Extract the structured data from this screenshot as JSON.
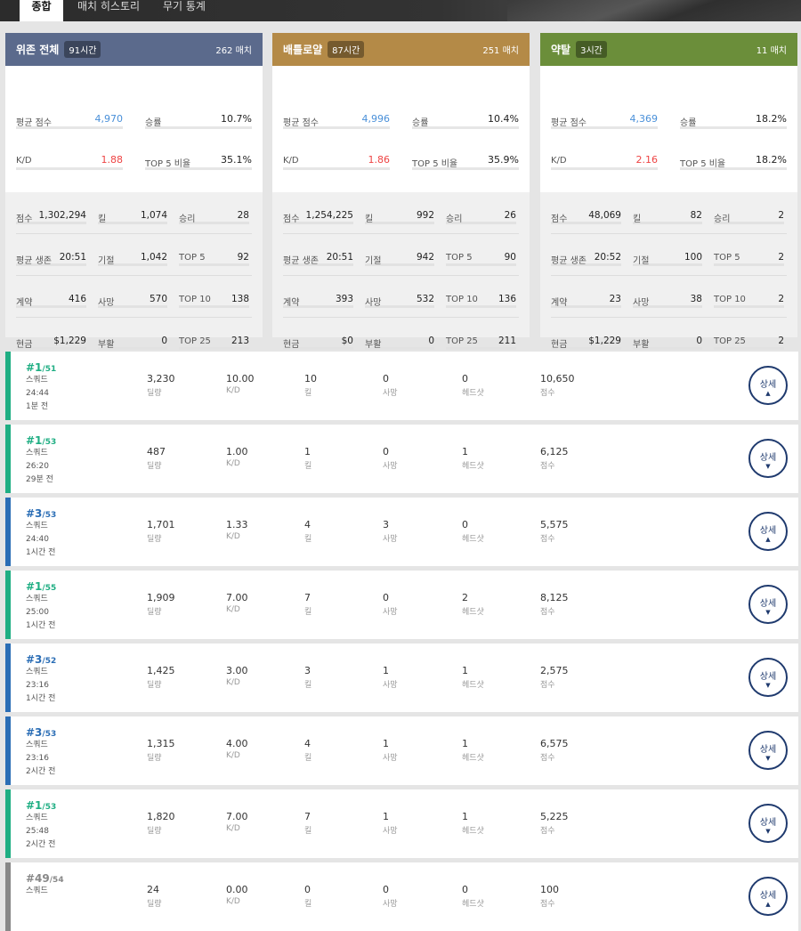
{
  "tabs": [
    "종합",
    "매치 히스토리",
    "무기 통계"
  ],
  "cards": [
    {
      "name": "위존 전체",
      "hours": "91시간",
      "matches": "262 매치",
      "color": "#5b6a8c",
      "avg_score": "4,970",
      "win_rate": "10.7%",
      "kd": "1.88",
      "top5": "35.1%",
      "stats": [
        [
          "점수",
          "1,302,294",
          "킬",
          "1,074",
          "승리",
          "28"
        ],
        [
          "평균 생존",
          "20:51",
          "기절",
          "1,042",
          "TOP 5",
          "92"
        ],
        [
          "계약",
          "416",
          "사망",
          "570",
          "TOP 10",
          "138"
        ],
        [
          "현금",
          "$1,229",
          "부활",
          "0",
          "TOP 25",
          "213"
        ]
      ]
    },
    {
      "name": "배틀로얄",
      "hours": "87시간",
      "matches": "251 매치",
      "color": "#b48a47",
      "avg_score": "4,996",
      "win_rate": "10.4%",
      "kd": "1.86",
      "top5": "35.9%",
      "stats": [
        [
          "점수",
          "1,254,225",
          "킬",
          "992",
          "승리",
          "26"
        ],
        [
          "평균 생존",
          "20:51",
          "기절",
          "942",
          "TOP 5",
          "90"
        ],
        [
          "계약",
          "393",
          "사망",
          "532",
          "TOP 10",
          "136"
        ],
        [
          "현금",
          "$0",
          "부활",
          "0",
          "TOP 25",
          "211"
        ]
      ]
    },
    {
      "name": "약탈",
      "hours": "3시간",
      "matches": "11 매치",
      "color": "#6b8e3a",
      "avg_score": "4,369",
      "win_rate": "18.2%",
      "kd": "2.16",
      "top5": "18.2%",
      "stats": [
        [
          "점수",
          "48,069",
          "킬",
          "82",
          "승리",
          "2"
        ],
        [
          "평균 생존",
          "20:52",
          "기절",
          "100",
          "TOP 5",
          "2"
        ],
        [
          "계약",
          "23",
          "사망",
          "38",
          "TOP 10",
          "2"
        ],
        [
          "현금",
          "$1,229",
          "부활",
          "0",
          "TOP 25",
          "2"
        ]
      ]
    }
  ],
  "card_labels": {
    "avg_score": "평균 점수",
    "win_rate": "승률",
    "kd": "K/D",
    "top5": "TOP 5 비율"
  },
  "match_labels": {
    "damage": "딜량",
    "kd": "K/D",
    "kills": "킬",
    "deaths": "사망",
    "headshots": "헤드샷",
    "score": "점수",
    "detail": "상세"
  },
  "matches": [
    {
      "rank": "#1",
      "total": "/51",
      "mode": "스쿼드",
      "time": "24:44",
      "ago": "1분 전",
      "damage": "3,230",
      "kd": "10.00",
      "kills": "10",
      "deaths": "0",
      "headshots": "0",
      "score": "10,650",
      "color": "#1fae83",
      "open": true
    },
    {
      "rank": "#1",
      "total": "/53",
      "mode": "스쿼드",
      "time": "26:20",
      "ago": "29분 전",
      "damage": "487",
      "kd": "1.00",
      "kills": "1",
      "deaths": "0",
      "headshots": "1",
      "score": "6,125",
      "color": "#1fae83",
      "open": false
    },
    {
      "rank": "#3",
      "total": "/53",
      "mode": "스쿼드",
      "time": "24:40",
      "ago": "1시간 전",
      "damage": "1,701",
      "kd": "1.33",
      "kills": "4",
      "deaths": "3",
      "headshots": "0",
      "score": "5,575",
      "color": "#2a6db5",
      "open": true
    },
    {
      "rank": "#1",
      "total": "/55",
      "mode": "스쿼드",
      "time": "25:00",
      "ago": "1시간 전",
      "damage": "1,909",
      "kd": "7.00",
      "kills": "7",
      "deaths": "0",
      "headshots": "2",
      "score": "8,125",
      "color": "#1fae83",
      "open": false
    },
    {
      "rank": "#3",
      "total": "/52",
      "mode": "스쿼드",
      "time": "23:16",
      "ago": "1시간 전",
      "damage": "1,425",
      "kd": "3.00",
      "kills": "3",
      "deaths": "1",
      "headshots": "1",
      "score": "2,575",
      "color": "#2a6db5",
      "open": false
    },
    {
      "rank": "#3",
      "total": "/53",
      "mode": "스쿼드",
      "time": "23:16",
      "ago": "2시간 전",
      "damage": "1,315",
      "kd": "4.00",
      "kills": "4",
      "deaths": "1",
      "headshots": "1",
      "score": "6,575",
      "color": "#2a6db5",
      "open": false
    },
    {
      "rank": "#1",
      "total": "/53",
      "mode": "스쿼드",
      "time": "25:48",
      "ago": "2시간 전",
      "damage": "1,820",
      "kd": "7.00",
      "kills": "7",
      "deaths": "1",
      "headshots": "1",
      "score": "5,225",
      "color": "#1fae83",
      "open": false
    },
    {
      "rank": "#49",
      "total": "/54",
      "mode": "스쿼드",
      "time": "",
      "ago": "",
      "damage": "24",
      "kd": "0.00",
      "kills": "0",
      "deaths": "0",
      "headshots": "0",
      "score": "100",
      "color": "#888888",
      "open": true
    }
  ]
}
